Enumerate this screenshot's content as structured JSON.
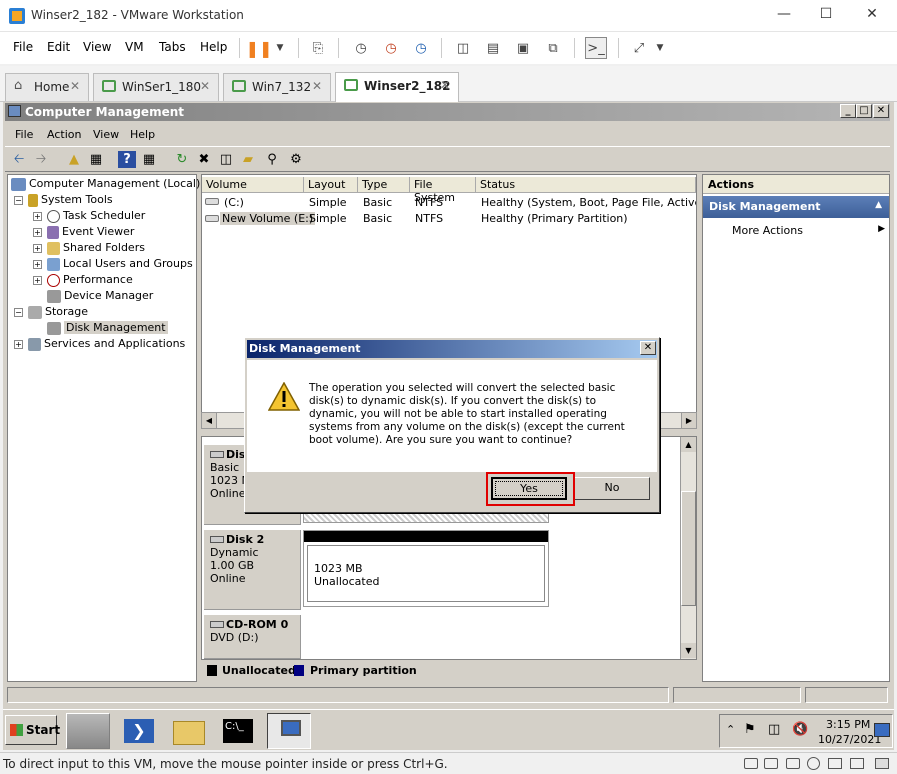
{
  "vmware": {
    "window_title": "Winser2_182 - VMware Workstation",
    "menu": [
      "File",
      "Edit",
      "View",
      "VM",
      "Tabs",
      "Help"
    ],
    "tabs": [
      {
        "label": "Home"
      },
      {
        "label": "WinSer1_180"
      },
      {
        "label": "Win7_132"
      },
      {
        "label": "Winser2_182"
      }
    ],
    "status_hint": "To direct input to this VM, move the mouse pointer inside or press Ctrl+G."
  },
  "cm": {
    "title": "Computer Management",
    "menu": [
      "File",
      "Action",
      "View",
      "Help"
    ],
    "tree": [
      {
        "label": "Computer Management (Local)"
      },
      {
        "label": "System Tools"
      },
      {
        "label": "Task Scheduler"
      },
      {
        "label": "Event Viewer"
      },
      {
        "label": "Shared Folders"
      },
      {
        "label": "Local Users and Groups"
      },
      {
        "label": "Performance"
      },
      {
        "label": "Device Manager"
      },
      {
        "label": "Storage"
      },
      {
        "label": "Disk Management"
      },
      {
        "label": "Services and Applications"
      }
    ],
    "columns": [
      "Volume",
      "Layout",
      "Type",
      "File System",
      "Status"
    ],
    "volumes": [
      {
        "volume": "(C:)",
        "layout": "Simple",
        "type": "Basic",
        "fs": "NTFS",
        "status": "Healthy (System, Boot, Page File, Active, Cra"
      },
      {
        "volume": "New Volume (E:)",
        "layout": "Simple",
        "type": "Basic",
        "fs": "NTFS",
        "status": "Healthy (Primary Partition)"
      }
    ],
    "disk1": {
      "name": "Dis",
      "type": "Basic",
      "size": "1023 M",
      "state": "Online"
    },
    "disk2": {
      "name": "Disk 2",
      "type": "Dynamic",
      "size": "1.00 GB",
      "state": "Online",
      "part_size": "1023 MB",
      "part_state": "Unallocated"
    },
    "cdrom": {
      "name": "CD-ROM 0",
      "drive": "DVD (D:)"
    },
    "legend": {
      "unalloc": "Unallocated",
      "primary": "Primary partition"
    },
    "actions": {
      "header": "Actions",
      "section": "Disk Management",
      "more": "More Actions"
    }
  },
  "dialog": {
    "title": "Disk Management",
    "message": "The operation you selected will convert the selected basic disk(s) to dynamic disk(s). If you convert the disk(s) to dynamic, you will not be able to start installed operating systems from any volume on the disk(s) (except the current boot volume). Are you sure you want to continue?",
    "yes": "Yes",
    "no": "No"
  },
  "taskbar": {
    "start": "Start",
    "time": "3:15 PM",
    "date": "10/27/2021"
  },
  "colors": {
    "unalloc": "#000000",
    "primary": "#000080",
    "highlight": "#e00000",
    "action_header": "#4a6fa5"
  }
}
